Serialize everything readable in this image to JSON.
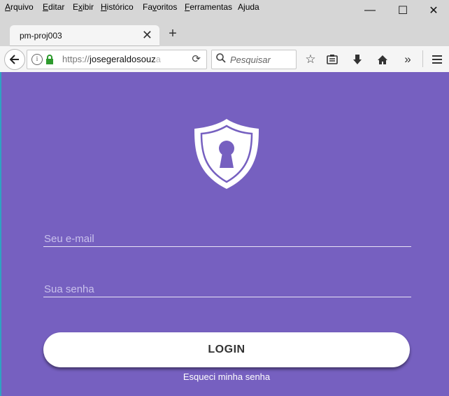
{
  "menu": [
    "Arquivo",
    "Editar",
    "Exibir",
    "Histórico",
    "Favoritos",
    "Ferramentas",
    "Ajuda"
  ],
  "menu_underline": [
    "A",
    "E",
    "x",
    "H",
    "v",
    "F",
    "j"
  ],
  "window": {
    "minimize": "—",
    "maximize": "☐",
    "close": "✕"
  },
  "tab": {
    "title": "pm-proj003",
    "close": "✕",
    "new": "+"
  },
  "address": {
    "scheme": "https://",
    "host": "josegeraldosouz",
    "fade": "a"
  },
  "search": {
    "placeholder": "Pesquisar"
  },
  "login_page": {
    "email_placeholder": "Seu e-mail",
    "password_placeholder": "Sua senha",
    "login_label": "LOGIN",
    "forgot_label": "Esqueci minha senha"
  },
  "colors": {
    "background": "#7660C0",
    "accent": "#ffffff"
  },
  "icons": [
    "back-arrow-icon",
    "info-icon",
    "lock-icon",
    "reload-icon",
    "search-icon",
    "bookmark-star-icon",
    "reading-list-icon",
    "download-icon",
    "home-icon",
    "overflow-icon",
    "hamburger-menu-icon",
    "shield-lock-icon"
  ]
}
